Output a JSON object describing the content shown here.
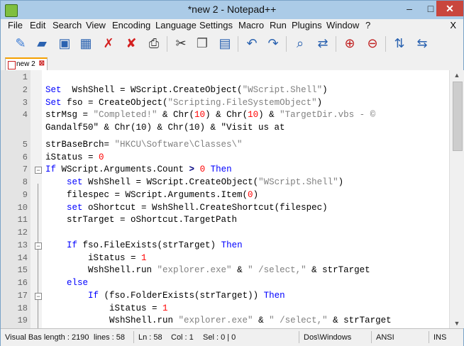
{
  "window": {
    "title": "*new  2 - Notepad++",
    "minimize": "–",
    "maximize": "□",
    "close": "✕"
  },
  "menu": [
    "File",
    "Edit",
    "Search",
    "View",
    "Encoding",
    "Language",
    "Settings",
    "Macro",
    "Run",
    "Plugins",
    "Window",
    "?"
  ],
  "menu_close": "X",
  "toolbar_icons": [
    "new-file-icon",
    "open-file-icon",
    "save-icon",
    "save-all-icon",
    "close-icon",
    "close-all-icon",
    "print-icon",
    "cut-icon",
    "copy-icon",
    "paste-icon",
    "undo-icon",
    "redo-icon",
    "find-icon",
    "replace-icon",
    "zoom-in-icon",
    "zoom-out-icon",
    "sync-vertical-icon",
    "sync-horizontal-icon"
  ],
  "tab": {
    "label": "new  2",
    "close": "⊠"
  },
  "lines": [
    {
      "n": "1",
      "fold": "",
      "parts": []
    },
    {
      "n": "2",
      "fold": "",
      "parts": [
        [
          "kw",
          "Set"
        ],
        [
          "",
          "  WshShell = WScript.CreateObject("
        ],
        [
          "str",
          "\"WScript.Shell\""
        ],
        [
          "",
          ")"
        ]
      ]
    },
    {
      "n": "3",
      "fold": "",
      "parts": [
        [
          "kw",
          "Set"
        ],
        [
          "",
          " fso = CreateObject("
        ],
        [
          "str",
          "\"Scripting.FileSystemObject\""
        ],
        [
          "",
          ")"
        ]
      ]
    },
    {
      "n": "4",
      "fold": "",
      "parts": [
        [
          "",
          "strMsg = "
        ],
        [
          "str",
          "\"Completed!\""
        ],
        [
          "",
          " & Chr("
        ],
        [
          "num",
          "10"
        ],
        [
          "",
          ") & Chr("
        ],
        [
          "num",
          "10"
        ],
        [
          "",
          ") & "
        ],
        [
          "str",
          "\"TargetDir.vbs - ©"
        ]
      ]
    },
    {
      "n": "",
      "fold": "",
      "parts": [
        [
          "",
          "Gandalf50\" & Chr(10) & Chr(10) & \"Visit us at"
        ]
      ]
    },
    {
      "n": "5",
      "fold": "",
      "parts": [
        [
          "",
          "strBaseBrch= "
        ],
        [
          "str",
          "\"HKCU\\Software\\Classes\\\""
        ]
      ]
    },
    {
      "n": "6",
      "fold": "",
      "parts": [
        [
          "",
          "iStatus = "
        ],
        [
          "num",
          "0"
        ]
      ]
    },
    {
      "n": "7",
      "fold": "box",
      "parts": [
        [
          "kw",
          "If"
        ],
        [
          "",
          " WScript.Arguments.Count "
        ],
        [
          "op",
          ">"
        ],
        [
          "",
          " "
        ],
        [
          "num",
          "0"
        ],
        [
          "",
          " "
        ],
        [
          "kw",
          "Then"
        ]
      ]
    },
    {
      "n": "8",
      "fold": "",
      "parts": [
        [
          "",
          "    "
        ],
        [
          "kw",
          "set"
        ],
        [
          "",
          " WshShell = WScript.CreateObject("
        ],
        [
          "str",
          "\"WScript.Shell\""
        ],
        [
          "",
          ")"
        ]
      ]
    },
    {
      "n": "9",
      "fold": "",
      "parts": [
        [
          "",
          "    filespec = WScript.Arguments.Item("
        ],
        [
          "num",
          "0"
        ],
        [
          "",
          ")"
        ]
      ]
    },
    {
      "n": "10",
      "fold": "",
      "parts": [
        [
          "",
          "    "
        ],
        [
          "kw",
          "set"
        ],
        [
          "",
          " oShortcut = WshShell.CreateShortcut(filespec)"
        ]
      ]
    },
    {
      "n": "11",
      "fold": "",
      "parts": [
        [
          "",
          "    strTarget = oShortcut.TargetPath"
        ]
      ]
    },
    {
      "n": "12",
      "fold": "",
      "parts": []
    },
    {
      "n": "13",
      "fold": "box",
      "parts": [
        [
          "",
          "    "
        ],
        [
          "kw",
          "If"
        ],
        [
          "",
          " fso.FileExists(strTarget) "
        ],
        [
          "kw",
          "Then"
        ]
      ]
    },
    {
      "n": "14",
      "fold": "",
      "parts": [
        [
          "",
          "        iStatus = "
        ],
        [
          "num",
          "1"
        ]
      ]
    },
    {
      "n": "15",
      "fold": "",
      "parts": [
        [
          "",
          "        WshShell.run "
        ],
        [
          "str",
          "\"explorer.exe\""
        ],
        [
          "",
          " & "
        ],
        [
          "str",
          "\" /select,\""
        ],
        [
          "",
          " & strTarget"
        ]
      ]
    },
    {
      "n": "16",
      "fold": "",
      "parts": [
        [
          "",
          "    "
        ],
        [
          "kw",
          "else"
        ]
      ]
    },
    {
      "n": "17",
      "fold": "box",
      "parts": [
        [
          "",
          "        "
        ],
        [
          "kw",
          "If"
        ],
        [
          "",
          " (fso.FolderExists(strTarget)) "
        ],
        [
          "kw",
          "Then"
        ]
      ]
    },
    {
      "n": "18",
      "fold": "",
      "parts": [
        [
          "",
          "            iStatus = "
        ],
        [
          "num",
          "1"
        ]
      ]
    },
    {
      "n": "19",
      "fold": "",
      "parts": [
        [
          "",
          "            WshShell.run "
        ],
        [
          "str",
          "\"explorer.exe\""
        ],
        [
          "",
          " & "
        ],
        [
          "str",
          "\" /select,\""
        ],
        [
          "",
          " & strTarget"
        ]
      ]
    }
  ],
  "status": {
    "filetype": "Visual Bas length : 2190",
    "lines": "lines : 58",
    "ln": "Ln : 58",
    "col": "Col : 1",
    "sel": "Sel : 0 | 0",
    "eol": "Dos\\Windows",
    "encoding": "ANSI",
    "mode": "INS"
  },
  "colors": {
    "titlebar": "#abcbe7",
    "keyword": "#0000ff",
    "string": "#808080",
    "number": "#ff0000",
    "close": "#c9463d"
  }
}
